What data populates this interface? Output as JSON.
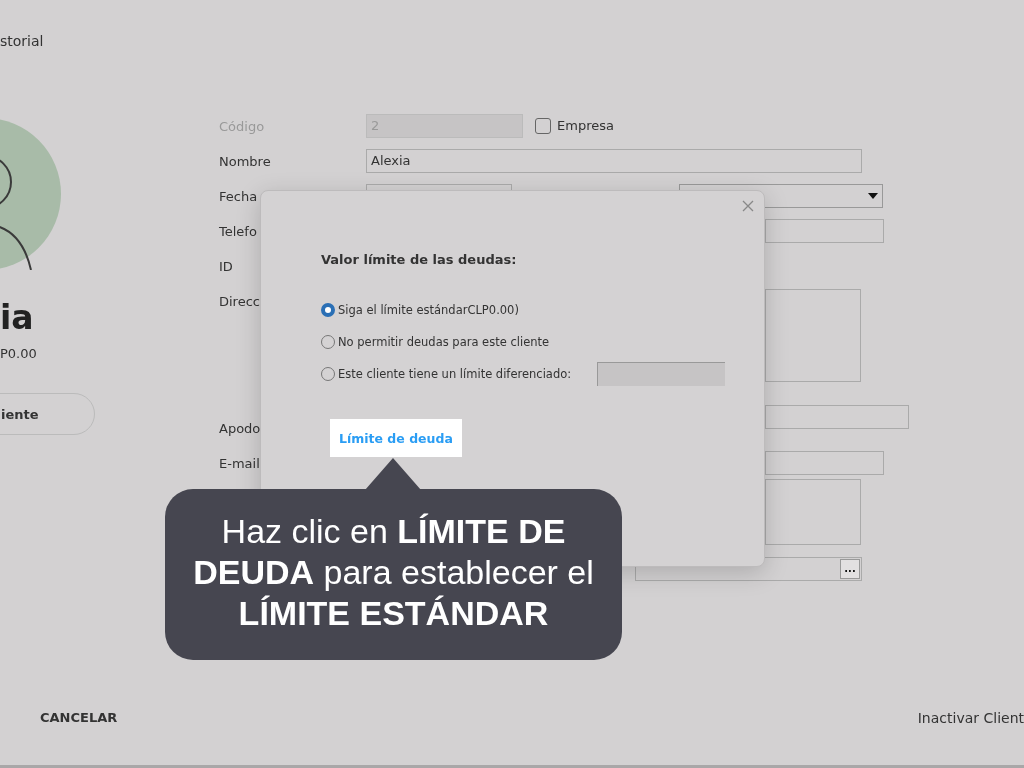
{
  "header": {
    "tab": "storial"
  },
  "profile": {
    "name": "ia",
    "balance": "P0.00",
    "button": "iente"
  },
  "form": {
    "rows": [
      {
        "kind": "code",
        "label": "Código",
        "value": "2",
        "disabled": true,
        "checkbox": {
          "label": "Empresa",
          "checked": false
        }
      },
      {
        "kind": "text",
        "label": "Nombre",
        "value": "Alexia"
      },
      {
        "kind": "date_select",
        "label": "Fecha"
      },
      {
        "kind": "side_field",
        "label": "Telefo"
      },
      {
        "kind": "plain",
        "label": "ID"
      },
      {
        "kind": "side_area",
        "label": "Direcc"
      },
      {
        "kind": "side_wide",
        "label": "Apodo"
      },
      {
        "kind": "side_field",
        "label": "E-mail"
      },
      {
        "kind": "side_area_short"
      },
      {
        "kind": "picker",
        "button": "..."
      }
    ]
  },
  "dialog": {
    "title": "Valor límite de las deudas:",
    "options": [
      {
        "kind": "plain",
        "label": "Siga el límite estándarCLP0.00)",
        "selected": true
      },
      {
        "kind": "plain",
        "label": "No permitir deudas para este cliente",
        "selected": false
      },
      {
        "kind": "with_field",
        "label": "Este cliente tiene un límite diferenciado:",
        "selected": false
      }
    ],
    "link": "Límite de deuda"
  },
  "callout": {
    "text": "Haz clic en **LÍMITE DE DEUDA** para establecer el **LÍMITE ESTÁNDAR**"
  },
  "footer": {
    "cancel": "CANCELAR",
    "deactivate": "Inactivar Client"
  }
}
